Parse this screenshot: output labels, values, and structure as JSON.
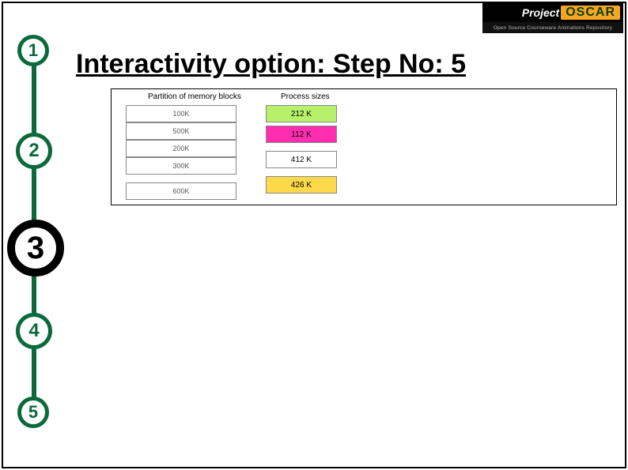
{
  "logo": {
    "brand_left": "Project",
    "brand_right": "OSCAR",
    "tagline": "Open Source Courseware Animations Repository"
  },
  "heading": "Interactivity option: Step No: 5",
  "steps": [
    "1",
    "2",
    "3",
    "4",
    "5"
  ],
  "diagram": {
    "partition_header": "Partition of memory blocks",
    "process_header": "Process sizes",
    "partitions": [
      "100K",
      "500K",
      "200K",
      "300K",
      "600K"
    ],
    "processes": [
      {
        "label": "212 K",
        "color": "#b7f06a"
      },
      {
        "label": "112 K",
        "color": "#ff2db0"
      },
      {
        "label": "412 K",
        "color": "#ffffff"
      },
      {
        "label": "426 K",
        "color": "#ffd94a"
      }
    ]
  }
}
